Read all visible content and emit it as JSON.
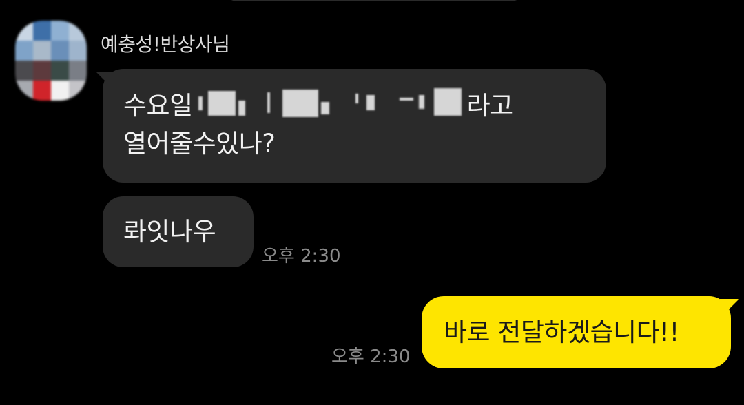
{
  "chat": {
    "incoming": {
      "sender_name": "예충성!반상사님",
      "messages": [
        {
          "line1_prefix": "수요일",
          "line1_suffix": "라고",
          "line2": "열어줄수있나?"
        },
        {
          "text": "롸잇나우",
          "time": "오후 2:30"
        }
      ]
    },
    "outgoing": {
      "messages": [
        {
          "text": "바로 전달하겠습니다!!",
          "time": "오후 2:30"
        }
      ]
    }
  },
  "colors": {
    "background": "#000000",
    "incoming_bubble": "#2a2a2a",
    "outgoing_bubble": "#fee500",
    "timestamp": "#8a8a8a"
  },
  "icons": {
    "avatar": "blurred-profile-photo"
  }
}
